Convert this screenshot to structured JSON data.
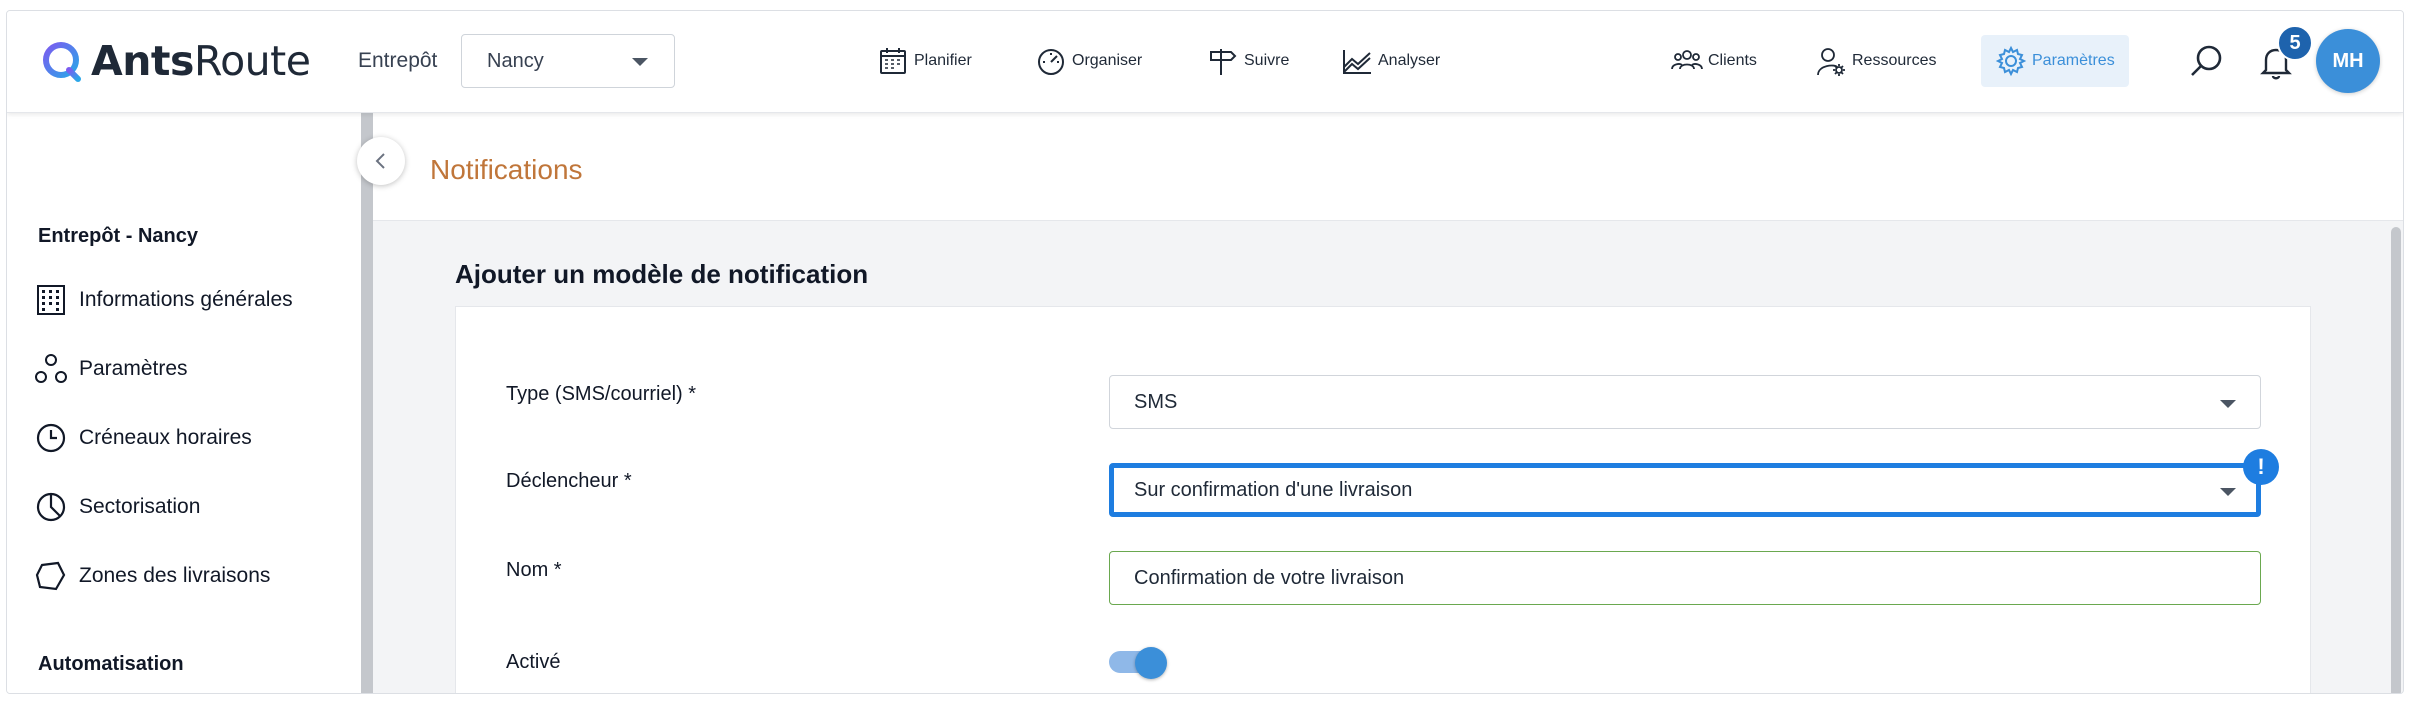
{
  "header": {
    "logo": {
      "brand_bold": "Ants",
      "brand_light": "Route"
    },
    "warehouse_label": "Entrepôt",
    "warehouse_value": "Nancy",
    "nav": [
      {
        "label": "Planifier",
        "icon": "calendar-icon"
      },
      {
        "label": "Organiser",
        "icon": "gauge-icon"
      },
      {
        "label": "Suivre",
        "icon": "signpost-icon"
      },
      {
        "label": "Analyser",
        "icon": "chart-icon"
      }
    ],
    "right_nav": [
      {
        "label": "Clients",
        "icon": "people-icon"
      },
      {
        "label": "Ressources",
        "icon": "user-gear-icon"
      },
      {
        "label": "Paramètres",
        "icon": "gear-icon",
        "active": true
      }
    ],
    "notifications_count": "5",
    "avatar_initials": "MH",
    "accent_color": "#3b8fd9"
  },
  "sidebar": {
    "section_title": "Entrepôt - Nancy",
    "items": [
      {
        "label": "Informations générales",
        "icon": "building-icon"
      },
      {
        "label": "Paramètres",
        "icon": "nodes-icon"
      },
      {
        "label": "Créneaux horaires",
        "icon": "clock-icon"
      },
      {
        "label": "Sectorisation",
        "icon": "pie-icon"
      },
      {
        "label": "Zones des livraisons",
        "icon": "polygon-icon"
      }
    ],
    "section2_title": "Automatisation"
  },
  "main": {
    "page_title": "Notifications",
    "form_title": "Ajouter un modèle de notification",
    "fields": {
      "type": {
        "label": "Type (SMS/courriel) *",
        "value": "SMS"
      },
      "trigger": {
        "label": "Déclencheur *",
        "value": "Sur confirmation d'une livraison",
        "warning": "!"
      },
      "name": {
        "label": "Nom *",
        "value": "Confirmation de votre livraison"
      },
      "active": {
        "label": "Activé",
        "value": true
      }
    }
  }
}
